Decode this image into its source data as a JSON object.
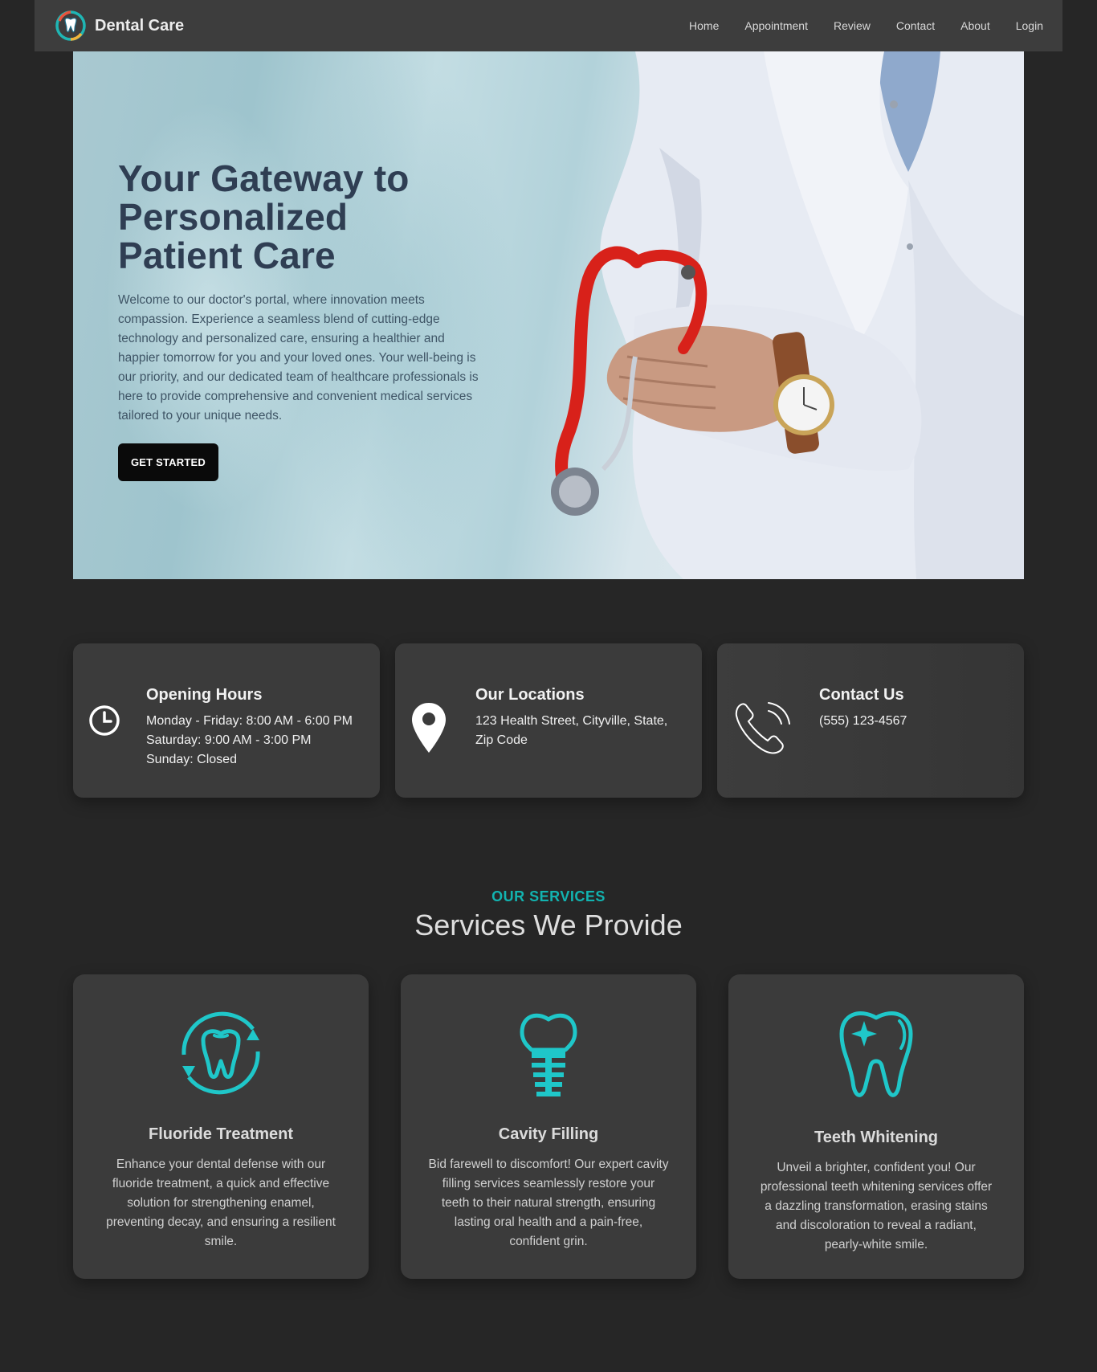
{
  "brand": {
    "name": "Dental Care",
    "logo_icon": "tooth-logo-icon"
  },
  "nav": {
    "links": [
      "Home",
      "Appointment",
      "Review",
      "Contact",
      "About",
      "Login"
    ]
  },
  "hero": {
    "title_lines": [
      "Your Gateway to",
      "Personalized",
      "Patient Care"
    ],
    "text": "Welcome to our doctor's portal, where innovation meets compassion. Experience a seamless blend of cutting-edge technology and personalized care, ensuring a healthier and happier tomorrow for you and your loved ones. Your well-being is our priority, and our dedicated team of healthcare professionals is here to provide comprehensive and convenient medical services tailored to your unique needs.",
    "button": "GET STARTED"
  },
  "info": [
    {
      "icon": "clock-icon",
      "title": "Opening Hours",
      "lines": [
        "Monday - Friday: 8:00 AM - 6:00 PM",
        "Saturday: 9:00 AM - 3:00 PM",
        "Sunday: Closed"
      ]
    },
    {
      "icon": "location-pin-icon",
      "title": "Our Locations",
      "lines": [
        "123 Health Street, Cityville, State,",
        "Zip Code"
      ]
    },
    {
      "icon": "phone-icon",
      "title": "Contact Us",
      "lines": [
        "(555) 123-4567"
      ]
    }
  ],
  "services": {
    "eyebrow": "OUR SERVICES",
    "title": "Services We Provide",
    "items": [
      {
        "icon": "tooth-refresh-icon",
        "name": "Fluoride Treatment",
        "desc": "Enhance your dental defense with our fluoride treatment, a quick and effective solution for strengthening enamel, preventing decay, and ensuring a resilient smile."
      },
      {
        "icon": "dental-implant-icon",
        "name": "Cavity Filling",
        "desc": "Bid farewell to discomfort! Our expert cavity filling services seamlessly restore your teeth to their natural strength, ensuring lasting oral health and a pain-free, confident grin."
      },
      {
        "icon": "sparkling-tooth-icon",
        "name": "Teeth Whitening",
        "desc": "Unveil a brighter, confident you! Our professional teeth whitening services offer a dazzling transformation, erasing stains and discoloration to reveal a radiant, pearly-white smile."
      }
    ]
  },
  "colors": {
    "accent": "#12b3b0",
    "icon_teal": "#1fc7c9",
    "page_bg": "#262626",
    "card_bg": "#3b3b3b",
    "nav_bg": "#3d3d3d"
  }
}
